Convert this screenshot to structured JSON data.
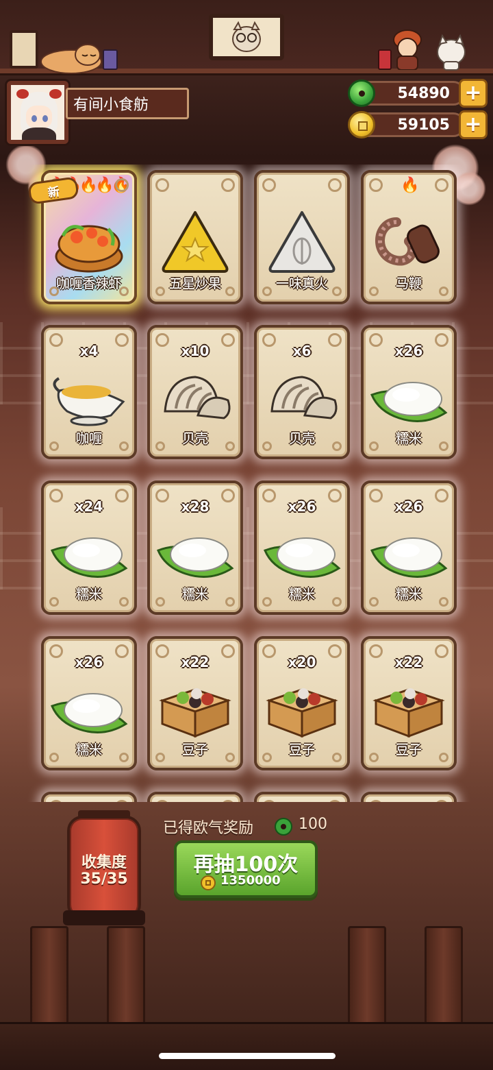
{
  "player": {
    "restaurant_name": "有间小食舫"
  },
  "currency": {
    "jade": "54890",
    "coin": "59105"
  },
  "colors": {
    "accent_green": "#5aa42c",
    "card_bg": "#efe2c6",
    "frame": "#5c3a26",
    "flame": "#ff5a1a"
  },
  "cards": [
    {
      "label": "咖喱香辣虾",
      "count": "",
      "art": "curry-shrimp-pot-icon",
      "new_badge": "新",
      "flames": "🔥🔥🔥🔥🔥",
      "special": true
    },
    {
      "label": "五星炒果",
      "count": "",
      "art": "yellow-triangle-star-icon",
      "flames": ""
    },
    {
      "label": "一味真火",
      "count": "",
      "art": "white-triangle-leaf-icon",
      "flames": ""
    },
    {
      "label": "马鞭",
      "count": "",
      "art": "whip-icon",
      "flames": "🔥"
    },
    {
      "label": "咖喱",
      "count": "x4",
      "art": "curry-gravy-boat-icon"
    },
    {
      "label": "贝壳",
      "count": "x10",
      "art": "clam-icon"
    },
    {
      "label": "贝壳",
      "count": "x6",
      "art": "clam-icon"
    },
    {
      "label": "糯米",
      "count": "x26",
      "art": "rice-leaf-icon"
    },
    {
      "label": "糯米",
      "count": "x24",
      "art": "rice-leaf-icon"
    },
    {
      "label": "糯米",
      "count": "x28",
      "art": "rice-leaf-icon"
    },
    {
      "label": "糯米",
      "count": "x26",
      "art": "rice-leaf-icon"
    },
    {
      "label": "糯米",
      "count": "x26",
      "art": "rice-leaf-icon"
    },
    {
      "label": "糯米",
      "count": "x26",
      "art": "rice-leaf-icon"
    },
    {
      "label": "豆子",
      "count": "x22",
      "art": "bean-box-icon"
    },
    {
      "label": "豆子",
      "count": "x20",
      "art": "bean-box-icon"
    },
    {
      "label": "豆子",
      "count": "x22",
      "art": "bean-box-icon"
    }
  ],
  "collection": {
    "title": "收集度",
    "value": "35/35"
  },
  "reward": {
    "text": "已得欧气奖励",
    "amount": "100"
  },
  "draw_button": {
    "label": "再抽100次",
    "cost": "1350000"
  }
}
